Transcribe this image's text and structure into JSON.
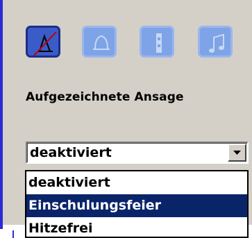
{
  "toolbar": {
    "buttons": [
      {
        "icon": "microphone-off-icon",
        "state": "active"
      },
      {
        "icon": "bell-icon",
        "state": "inactive"
      },
      {
        "icon": "speaker-icon",
        "state": "inactive"
      },
      {
        "icon": "music-note-icon",
        "state": "inactive"
      }
    ]
  },
  "section": {
    "label": "Aufgezeichnete Ansage"
  },
  "select": {
    "value": "deaktiviert",
    "options": [
      "deaktiviert",
      "Einschulungsfeier",
      "Hitzefrei"
    ],
    "highlighted": "Einschulungsfeier"
  },
  "colors": {
    "panel": "#d4d0c8",
    "accent": "#2b2bd6",
    "selection": "#0a246a",
    "button_active": "#3a5cc8",
    "button_inactive": "#7ea3e6"
  }
}
